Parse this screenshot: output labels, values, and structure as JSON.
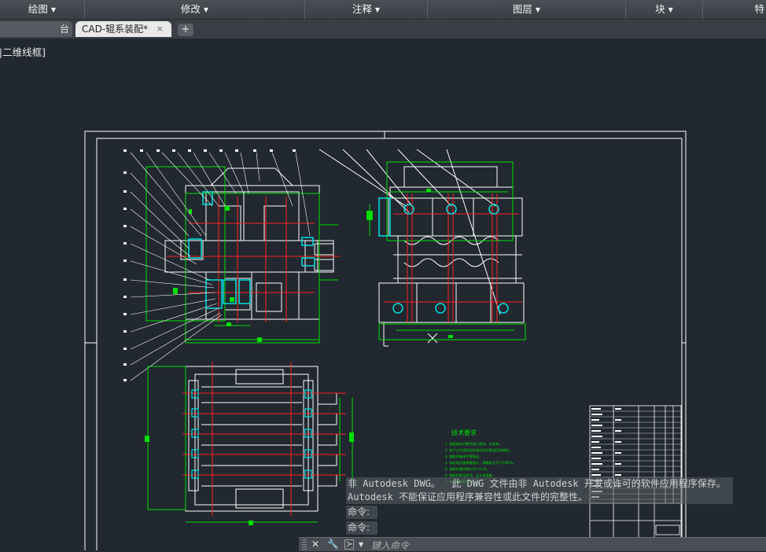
{
  "ribbon": {
    "panels": [
      {
        "label": "绘图"
      },
      {
        "label": "修改"
      },
      {
        "label": "注释"
      },
      {
        "label": "图层"
      },
      {
        "label": "块"
      },
      {
        "label": "特"
      }
    ]
  },
  "tabs": {
    "inactive_label": "台",
    "active_label": "CAD-辊系装配*",
    "close_glyph": "×",
    "add_glyph": "+"
  },
  "viewport": {
    "label": "]|二维线框]"
  },
  "drawing": {
    "tech_title": "技术要求",
    "tech_lines": [
      "1. 装配前应对零件进行清洗，去毛刺。",
      "2. 各个工作面的配合面应涂润滑油后再装配。",
      "3. 装配时轴承不得敲击。",
      "4. 齿轮啮合面接触良好，接触斑点不小于60%。",
      "5. 轴承外圈间隙0.03~0.05。",
      "6. 装配后转动灵活，无卡滞现象。",
      "7. 未注明倒角均为C1。"
    ]
  },
  "messages": {
    "line1": "非 Autodesk DWG。  此 DWG 文件由非 Autodesk 开发或许可的软件应用程序保存。",
    "line2": "Autodesk 不能保证应用程序兼容性或此文件的完整性。"
  },
  "command": {
    "history": [
      "命令:",
      "命令:"
    ],
    "prompt_glyph": "≻",
    "placeholder": "键入命令"
  },
  "colors": {
    "background": "#212830",
    "drawing_white": "#ffffff",
    "drawing_green": "#00e000",
    "drawing_red": "#ff2020",
    "drawing_cyan": "#00e0e0"
  }
}
